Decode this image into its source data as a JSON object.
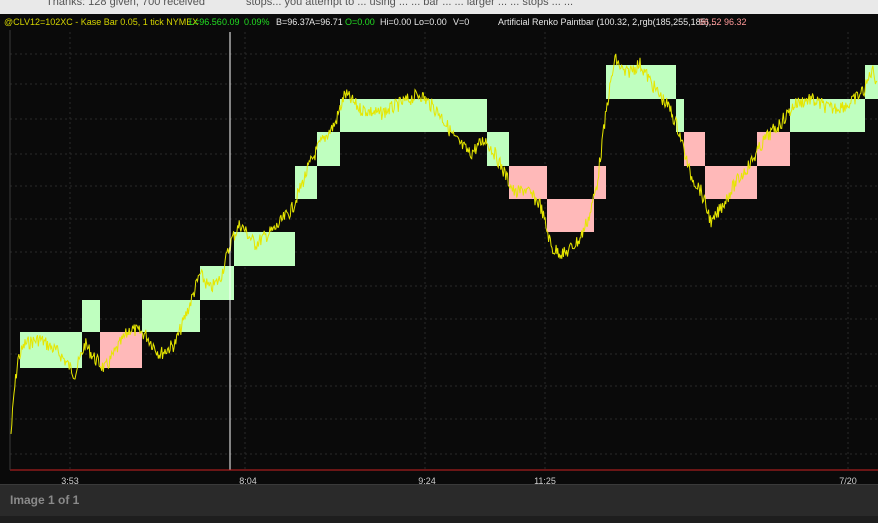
{
  "page": {
    "top_strip_left": "Thanks: 128 given, 700 received",
    "top_strip_right": "stops... you attempt to ... using ... ... bar ... ... larger ... ... stops ... ...",
    "footer_label": "Image 1 of 1"
  },
  "status_bar": {
    "symbol": "@CLV12=102XC - Kase Bar 0.05, 1 tick  NYMEX",
    "last": "L=96.56",
    "change": "0.09",
    "change_pct": "0.09%",
    "bid": "B=96.37",
    "ask": "A=96.71",
    "open": "O=0.00",
    "high": "Hi=0.00",
    "low": "Lo=0.00",
    "volume": "V=0",
    "study": "Artificial Renko Paintbar (100.32, 2,rgb(185,255,185),...",
    "study_value_1": "96.52",
    "study_value_2": "96.32"
  },
  "colors": {
    "up_brick": "#bfffbf",
    "down_brick": "#ffb9b9",
    "price_line": "#e6e600",
    "cursor_line": "#ffffff",
    "baseline": "#cc2222"
  },
  "chart_data": {
    "type": "renko-paintbar",
    "x_tick_labels": [
      "3:53",
      "8:04",
      "9:24",
      "11:25",
      "7/20"
    ],
    "bricks": [
      {
        "dir": "up",
        "top": 0,
        "bottom": 0
      },
      {
        "dir": "up",
        "top": 0,
        "bottom": 0
      },
      {
        "dir": "down",
        "top": 0,
        "bottom": 0
      },
      {
        "dir": "up",
        "top": 0,
        "bottom": 0
      },
      {
        "dir": "up",
        "top": 0,
        "bottom": 0
      },
      {
        "dir": "up",
        "top": 0,
        "bottom": 0
      },
      {
        "dir": "up",
        "top": 0,
        "bottom": 0
      },
      {
        "dir": "up",
        "top": 0,
        "bottom": 0
      },
      {
        "dir": "up",
        "top": 0,
        "bottom": 0
      },
      {
        "dir": "up",
        "top": 0,
        "bottom": 0
      },
      {
        "dir": "down",
        "top": 0,
        "bottom": 0
      },
      {
        "dir": "down",
        "top": 0,
        "bottom": 0
      },
      {
        "dir": "down",
        "top": 0,
        "bottom": 0
      },
      {
        "dir": "up",
        "top": 0,
        "bottom": 0
      },
      {
        "dir": "up",
        "top": 0,
        "bottom": 0
      },
      {
        "dir": "down",
        "top": 0,
        "bottom": 0
      },
      {
        "dir": "down",
        "top": 0,
        "bottom": 0
      },
      {
        "dir": "down",
        "top": 0,
        "bottom": 0
      },
      {
        "dir": "up",
        "top": 0,
        "bottom": 0
      },
      {
        "dir": "up",
        "top": 0,
        "bottom": 0
      }
    ]
  }
}
